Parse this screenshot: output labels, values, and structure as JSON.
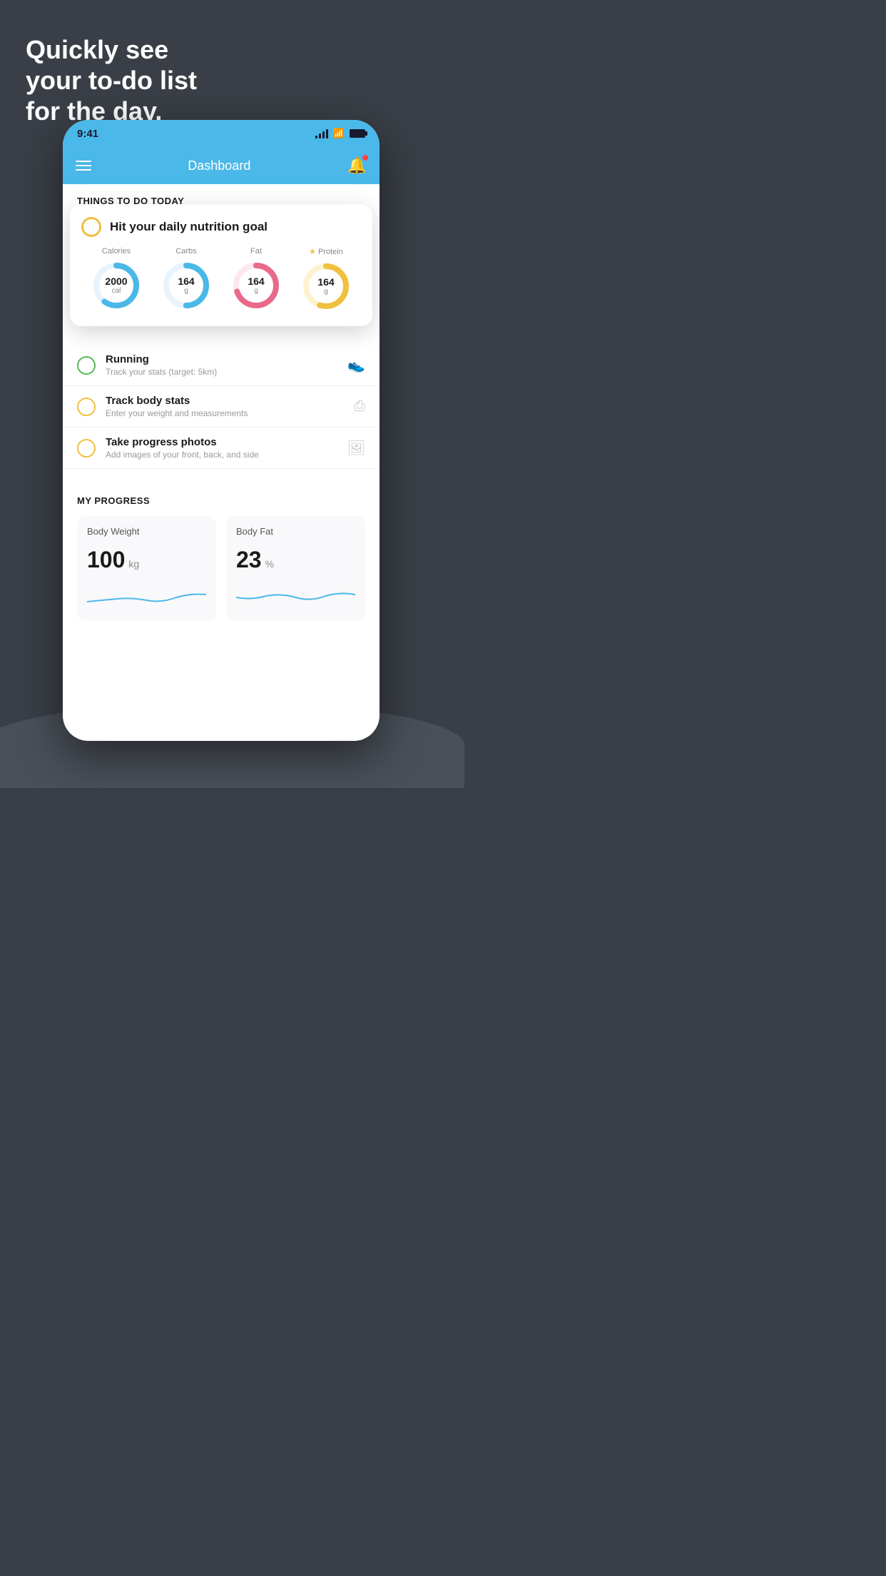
{
  "headline": {
    "line1": "Quickly see",
    "line2": "your to-do list",
    "line3": "for the day."
  },
  "statusBar": {
    "time": "9:41"
  },
  "navBar": {
    "title": "Dashboard"
  },
  "sectionHeader": "THINGS TO DO TODAY",
  "nutritionCard": {
    "title": "Hit your daily nutrition goal",
    "macros": [
      {
        "label": "Calories",
        "value": "2000",
        "unit": "cal",
        "color": "#4ab8e8",
        "starred": false,
        "progress": 0.6
      },
      {
        "label": "Carbs",
        "value": "164",
        "unit": "g",
        "color": "#4ab8e8",
        "starred": false,
        "progress": 0.5
      },
      {
        "label": "Fat",
        "value": "164",
        "unit": "g",
        "color": "#e86a8a",
        "starred": false,
        "progress": 0.7
      },
      {
        "label": "Protein",
        "value": "164",
        "unit": "g",
        "color": "#f0c040",
        "starred": true,
        "progress": 0.55
      }
    ]
  },
  "todoItems": [
    {
      "title": "Running",
      "subtitle": "Track your stats (target: 5km)",
      "circleColor": "green",
      "icon": "shoe"
    },
    {
      "title": "Track body stats",
      "subtitle": "Enter your weight and measurements",
      "circleColor": "yellow",
      "icon": "scale"
    },
    {
      "title": "Take progress photos",
      "subtitle": "Add images of your front, back, and side",
      "circleColor": "yellow",
      "icon": "photo"
    }
  ],
  "progressSection": {
    "title": "MY PROGRESS",
    "cards": [
      {
        "title": "Body Weight",
        "value": "100",
        "unit": "kg"
      },
      {
        "title": "Body Fat",
        "value": "23",
        "unit": "%"
      }
    ]
  }
}
